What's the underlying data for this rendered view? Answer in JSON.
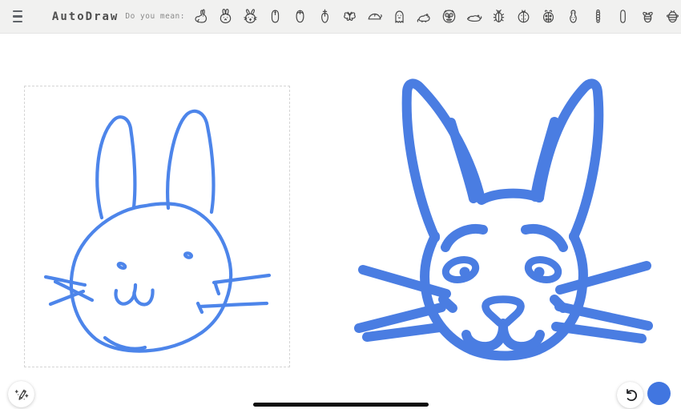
{
  "colors": {
    "accent_blue": "#4a7de2",
    "sketch_blue": "#4d85ea",
    "swatch_blue": "#4176e0",
    "topbar_bg": "#f1f1f0",
    "icon_gray": "#474747"
  },
  "topbar": {
    "title": "AutoDraw",
    "suggest_label": "Do you mean:",
    "suggestions": [
      "rabbit",
      "rabbit-face",
      "rabbit-face-2",
      "computer-mouse",
      "computer-mouse-2",
      "computer-mouse-3",
      "butterfly",
      "computer-mouse-side",
      "ghost",
      "rat",
      "owl",
      "rat-2",
      "beetle",
      "ladybug",
      "ladybug-2",
      "peanut",
      "caterpillar",
      "pill",
      "bee",
      "bee-2"
    ]
  },
  "canvas": {
    "user_sketch": "hand-drawn rabbit face",
    "autodraw_suggestion": "rabbit face clip art"
  },
  "controls": {
    "tool_icon": "magic-pencil",
    "undo_icon": "undo-arrow"
  }
}
